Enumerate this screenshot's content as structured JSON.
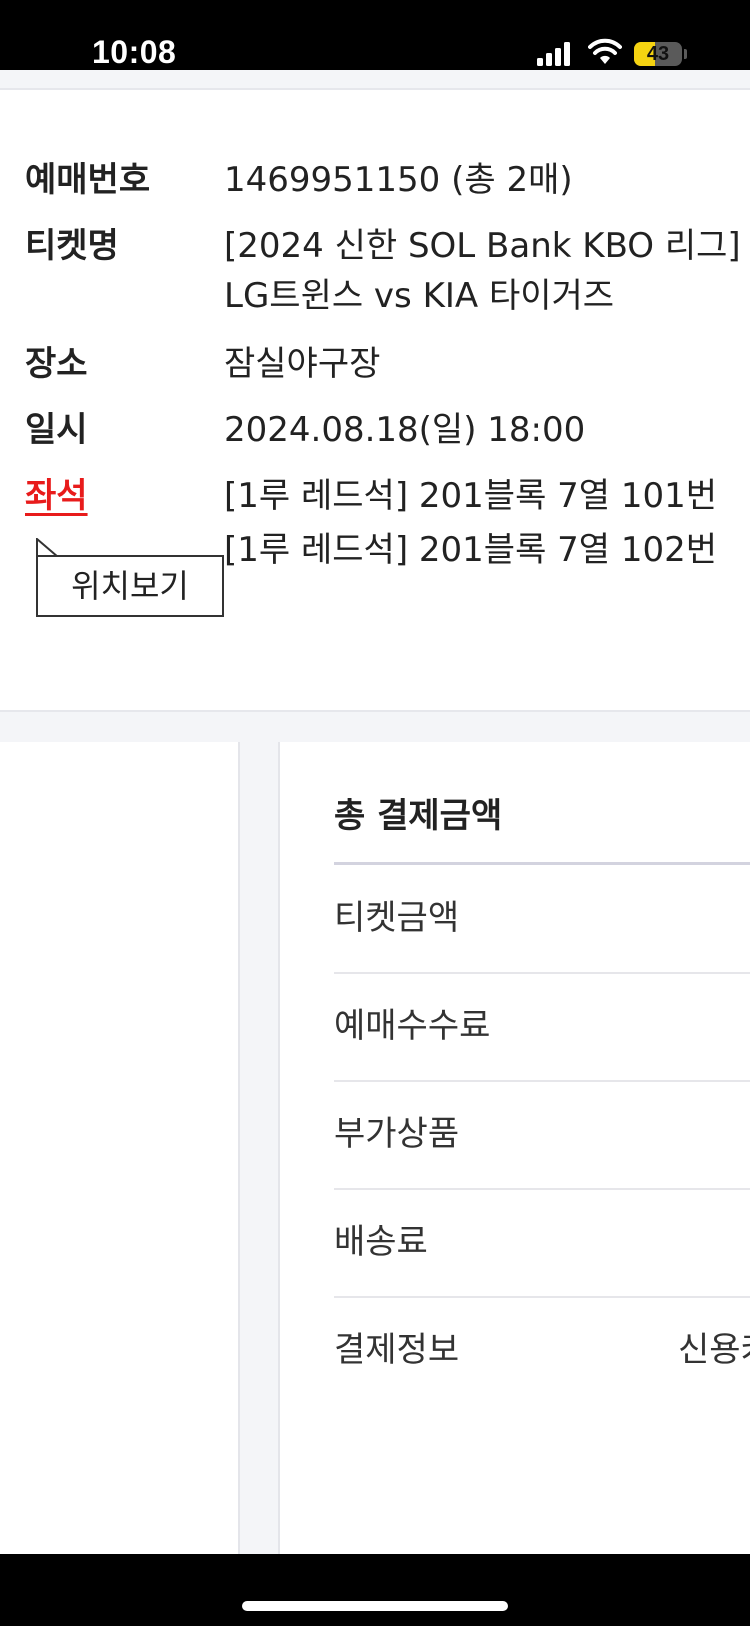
{
  "status_bar": {
    "time": "10:08",
    "battery_level": "43",
    "battery_fraction": 0.43,
    "icons": [
      "signal-icon",
      "wifi-icon",
      "battery-icon"
    ]
  },
  "reservation": {
    "booking_number": {
      "label": "예매번호",
      "value": "1469951150 (총 2매)"
    },
    "ticket_name": {
      "label": "티켓명",
      "line1": "[2024 신한 SOL Bank KBO 리그]",
      "line2": "LG트윈스 vs KIA 타이거즈"
    },
    "venue": {
      "label": "장소",
      "value": "잠실야구장"
    },
    "datetime": {
      "label": "일시",
      "value": "2024.08.18(일) 18:00"
    },
    "seat": {
      "label": "좌석",
      "seats": [
        "[1루 레드석] 201블록 7열 101번",
        "[1루 레드석] 201블록 7열 102번"
      ],
      "location_button": "위치보기"
    }
  },
  "payment": {
    "title": "총 결제금액",
    "rows": [
      {
        "label": "티켓금액",
        "value": ""
      },
      {
        "label": "예매수수료",
        "value": ""
      },
      {
        "label": "부가상품",
        "value": ""
      },
      {
        "label": "배송료",
        "value": ""
      },
      {
        "label": "결제정보",
        "value": "신용카"
      }
    ]
  },
  "colors": {
    "seat_label": "#e81b1b",
    "battery": "#f5d311",
    "page_gray": "#f4f5f8"
  }
}
